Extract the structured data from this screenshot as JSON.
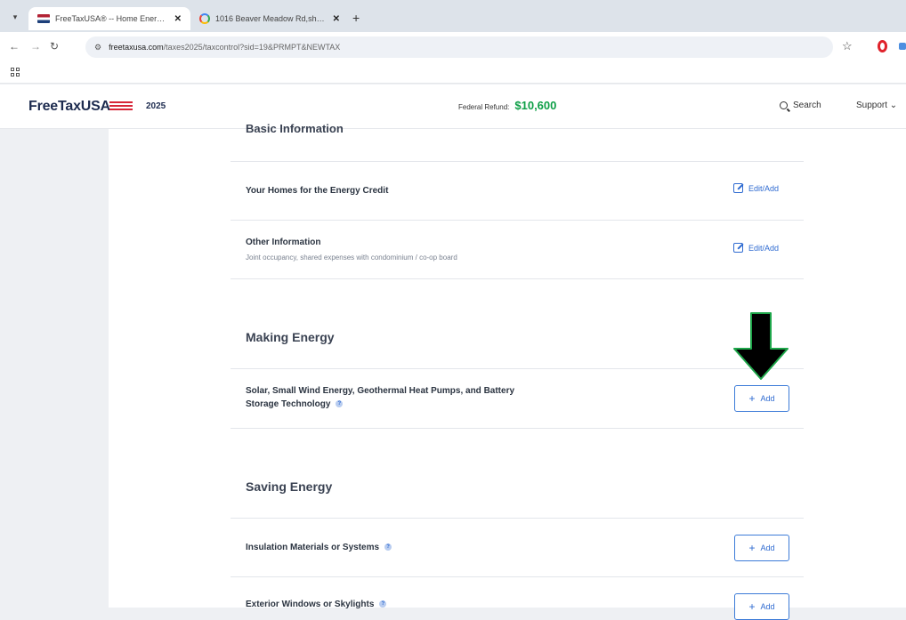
{
  "browser": {
    "tabs": [
      {
        "title": "FreeTaxUSA® -- Home Energy Cre",
        "close": "✕"
      },
      {
        "title": "1016 Beaver Meadow Rd,sharon",
        "close": "✕"
      }
    ],
    "new_tab": "+",
    "url_host": "freetaxusa.com",
    "url_path": "/taxes2025/taxcontrol?sid=19&PRMPT&NEWTAX"
  },
  "header": {
    "brand": "FreeTaxUSA",
    "year": "2025",
    "refund_label": "Federal Refund:",
    "refund_amount": "$10,600",
    "search_label": "Search",
    "support_label": "Support ⌄"
  },
  "sections": {
    "basic": {
      "heading": "Basic Information",
      "rows": [
        {
          "title": "Your Homes for the Energy Credit",
          "action": "Edit/Add"
        },
        {
          "title": "Other Information",
          "subtitle": "Joint occupancy, shared expenses with condominium / co-op board",
          "action": "Edit/Add"
        }
      ]
    },
    "making": {
      "heading": "Making Energy",
      "rows": [
        {
          "title_line1": "Solar, Small Wind Energy, Geothermal Heat Pumps, and Battery",
          "title_line2": "Storage Technology",
          "action": "Add"
        }
      ]
    },
    "saving": {
      "heading": "Saving Energy",
      "rows": [
        {
          "title": "Insulation Materials or Systems",
          "action": "Add"
        },
        {
          "title": "Exterior Windows or Skylights",
          "action": "Add"
        }
      ]
    }
  },
  "help_glyph": "?",
  "colors": {
    "brand_navy": "#1d2b4f",
    "refund_green": "#0e9f47",
    "link_blue": "#2f6bd1",
    "annotation_arrow": "#000000",
    "annotation_outline": "#1ea64a"
  }
}
